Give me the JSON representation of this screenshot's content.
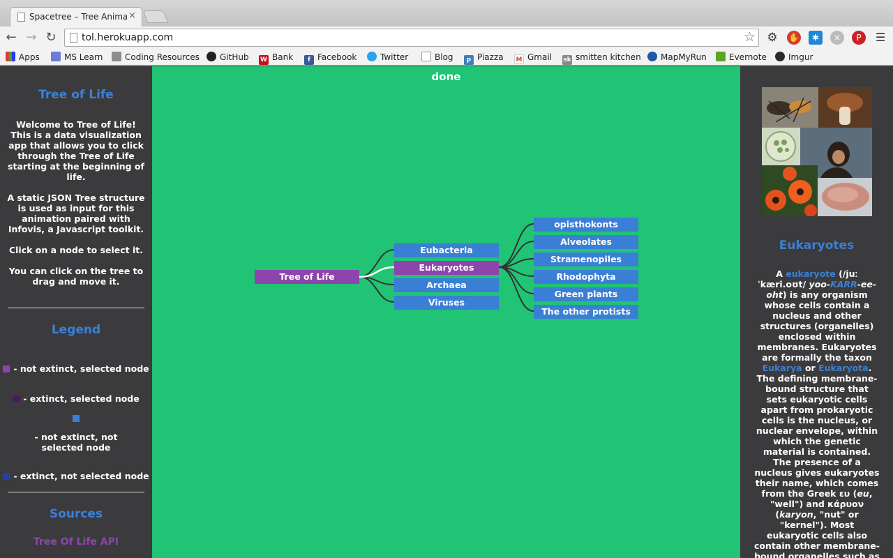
{
  "browser": {
    "tab_title": "Spacetree – Tree Animation",
    "tab_close": "×",
    "url": "tol.herokuapp.com",
    "bookmarks": [
      "Apps",
      "MS Learn",
      "Coding Resources",
      "GitHub",
      "Bank",
      "Facebook",
      "Twitter",
      "Blog",
      "Piazza",
      "Gmail",
      "smitten kitchen",
      "MapMyRun",
      "Evernote",
      "Imgur"
    ]
  },
  "sidebar": {
    "title": "Tree of Life",
    "intro": "Welcome to Tree of Life! This is a data visualization app that allows you to click through the Tree of Life starting at the beginning of life.",
    "json_note": "A static JSON Tree structure is used as input for this animation paired with Infovis, a Javascript toolkit.",
    "click_note": "Click on a node to select it.",
    "drag_note": "You can click on the tree to drag and move it.",
    "legend_title": "Legend",
    "legend": [
      {
        "label": "- not extinct, selected node",
        "color": "#8e44ad"
      },
      {
        "label": "- extinct, selected node",
        "color": "#4a1a5e"
      },
      {
        "label": "- not extinct, not selected node",
        "color": "#3a7fd6"
      },
      {
        "label": "- extinct, not selected node",
        "color": "#2242a8"
      }
    ],
    "sources_title": "Sources",
    "source_link": "Tree Of Life API"
  },
  "canvas": {
    "status": "done",
    "root": "Tree of Life",
    "level1": [
      "Eubacteria",
      "Eukaryotes",
      "Archaea",
      "Viruses"
    ],
    "selected_level1": "Eukaryotes",
    "level2": [
      "opisthokonts",
      "Alveolates",
      "Stramenopiles",
      "Rhodophyta",
      "Green plants",
      "The other protists"
    ]
  },
  "info_panel": {
    "title": "Eukaryotes",
    "text": {
      "a": "A ",
      "link1": "eukaryote",
      "pron": " (/juː ˈkæri.oʊt/ ",
      "pron_i": "yoo-",
      "pron_link": "KARR",
      "pron_i2": "-ee-oht",
      "t1": ") is any organism whose cells contain a nucleus and other structures (organelles) enclosed within membranes. Eukaryotes are formally the taxon ",
      "link2": "Eukarya",
      "or": " or ",
      "link3": "Eukaryota",
      "t2": ". The defining membrane-bound structure that sets eukaryotic cells apart from prokaryotic cells is the nucleus, or nuclear envelope, within which the genetic material is contained. The presence of a nucleus gives eukaryotes their name, which comes from the Greek ευ (",
      "eu": "eu",
      "t3": ", \"well\") and κάρυον (",
      "karyon": "karyon",
      "t4": ", \"nut\" or \"kernel\"). Most eukaryotic cells also contain other membrane-bound organelles such as"
    }
  },
  "colors": {
    "canvas_bg": "#20c474",
    "panel_bg": "#3b3b3d",
    "node": "#3a7fd6",
    "selected_node": "#8e44ad",
    "heading": "#3a80d8"
  }
}
